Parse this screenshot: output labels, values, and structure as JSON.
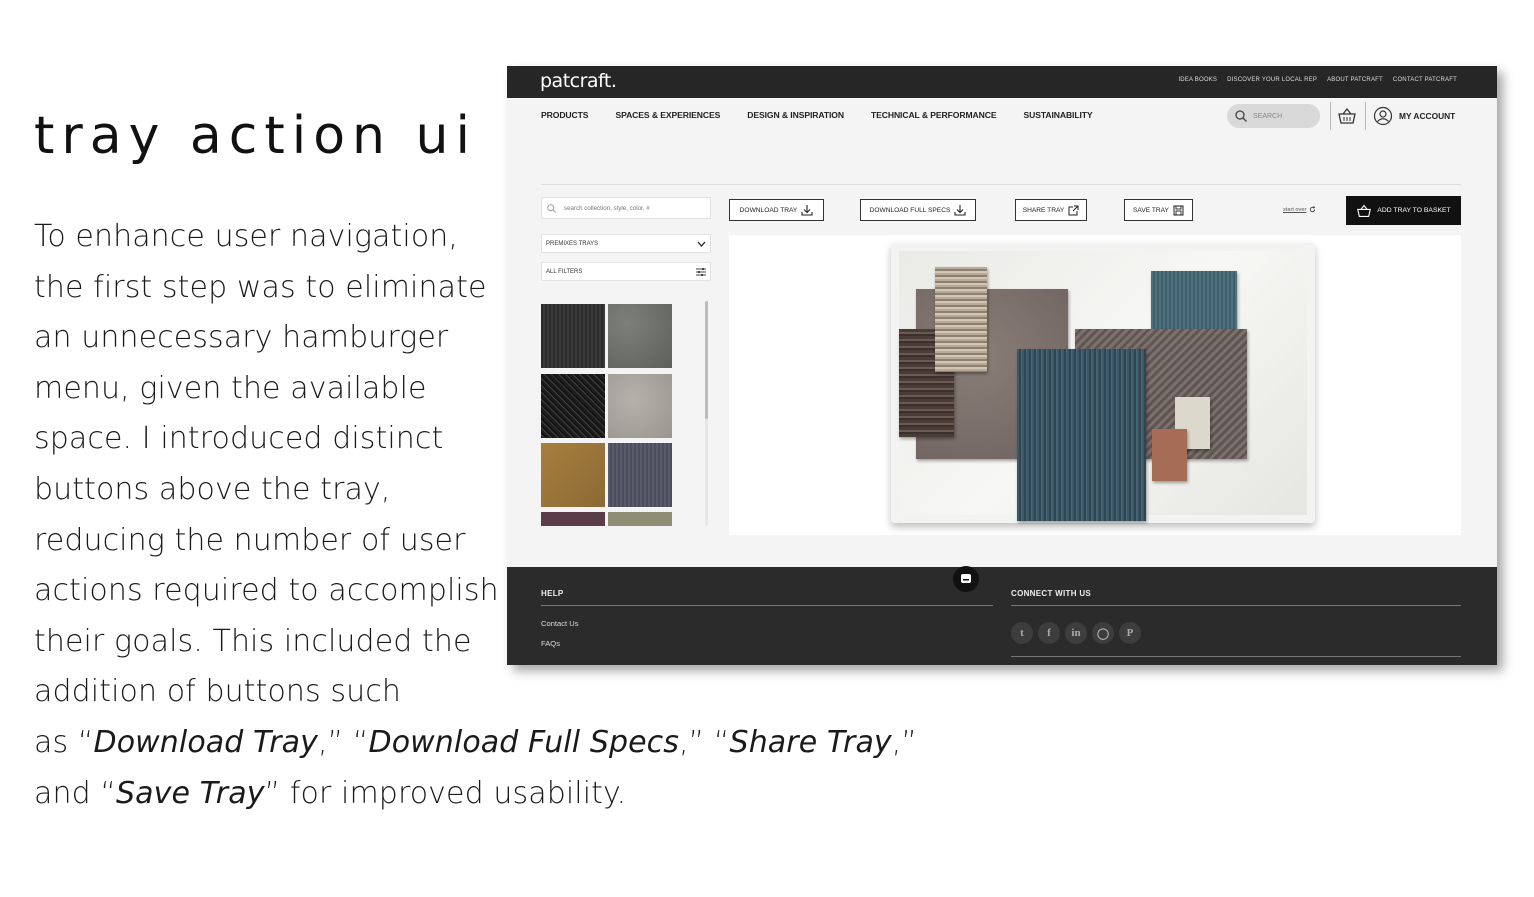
{
  "slide": {
    "title": "tray action ui",
    "body": {
      "line1": "To enhance user navigation,",
      "line2": "the first step was to eliminate",
      "line3": "an unnecessary hamburger",
      "line4": "menu, given the available",
      "line5": "space. I introduced distinct",
      "line6": "buttons above the tray,",
      "line7": "reducing the number of user",
      "line8": "actions required to accomplish",
      "line9": "their goals. This included the",
      "line10": "addition of buttons such",
      "line11_pre": "as “",
      "em1": "Download Tray",
      "sep1": ",” “",
      "em2": "Download Full Specs",
      "sep2": ",” “",
      "em3": "Share Tray",
      "sep3": ",”",
      "line12_pre": "and “",
      "em4": "Save Tray",
      "line12_post": "” for improved usability."
    }
  },
  "site": {
    "logo": "patcraft.",
    "top_links": [
      "IDEA BOOKS",
      "DISCOVER YOUR LOCAL REP",
      "ABOUT PATCRAFT",
      "CONTACT PATCRAFT"
    ],
    "nav": [
      "PRODUCTS",
      "SPACES & EXPERIENCES",
      "DESIGN & INSPIRATION",
      "TECHNICAL & PERFORMANCE",
      "SUSTAINABILITY"
    ],
    "search_placeholder": "SEARCH",
    "account_label": "MY ACCOUNT",
    "tray": {
      "search_placeholder": "search collection, style, color, #",
      "dropdown_trays": "PREMIXES TRAYS",
      "dropdown_filters": "ALL FILTERS",
      "download_tray": "DOWNLOAD TRAY",
      "download_specs": "DOWNLOAD FULL SPECS",
      "share_tray": "SHARE TRAY",
      "save_tray": "SAVE TRAY",
      "start_over": "start over",
      "add_to_basket": "ADD TRAY TO BASKET"
    },
    "footer": {
      "help_heading": "HELP",
      "help_links": [
        "Contact Us",
        "FAQs"
      ],
      "connect_heading": "CONNECT WITH US",
      "social_icons": [
        "twitter-icon",
        "facebook-icon",
        "linkedin-icon",
        "instagram-icon",
        "pinterest-icon"
      ]
    },
    "colors": {
      "topbar": "#262626",
      "basket_button": "#111111",
      "footer": "#2b2b2b"
    }
  }
}
